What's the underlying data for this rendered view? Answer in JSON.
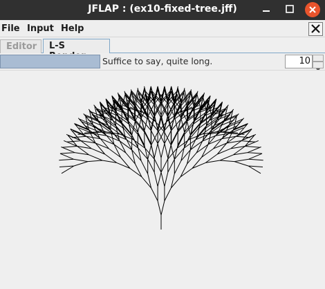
{
  "window": {
    "title": "JFLAP : (ex10-fixed-tree.jff)"
  },
  "menubar": {
    "items": [
      "File",
      "Input",
      "Help"
    ]
  },
  "tabs": [
    {
      "label": "Editor",
      "active": false
    },
    {
      "label": "L-S Render",
      "active": true
    }
  ],
  "toolbar": {
    "status_text": "Suffice to say, quite long.",
    "recursion_depth": "10"
  },
  "colors": {
    "titlebar": "#303030",
    "close_button": "#e9542c",
    "progress_fill": "#a9bcd3",
    "tab_accent": "#7ea6c7",
    "canvas_bg": "#efefef",
    "stroke": "#000000"
  }
}
